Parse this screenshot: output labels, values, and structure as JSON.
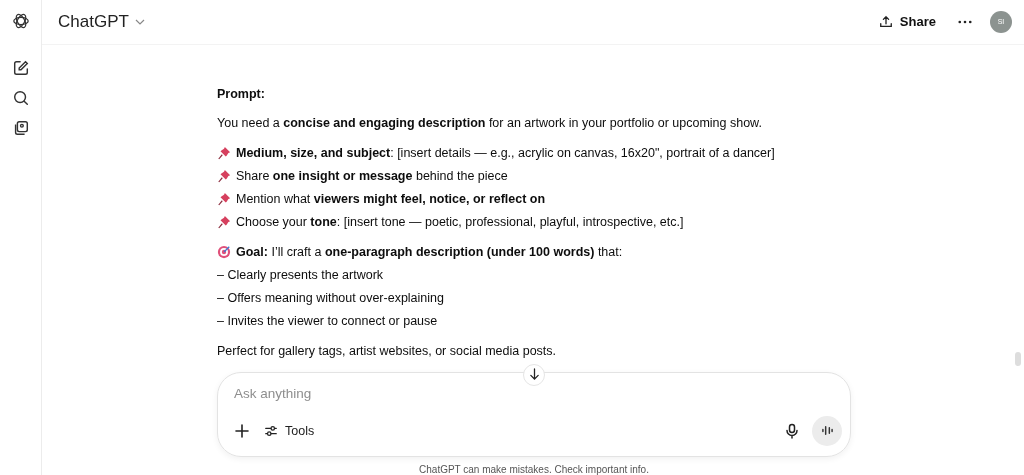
{
  "header": {
    "title": "ChatGPT",
    "share": "Share",
    "avatar": "SI"
  },
  "message": {
    "heading": "Prompt:",
    "intro": "You need a **concise and engaging description** for an artwork in your portfolio or upcoming show.",
    "bullets": [
      {
        "kind": "pin",
        "text": "**Medium, size, and subject**: [insert details — e.g., acrylic on canvas, 16x20\", portrait of a dancer]"
      },
      {
        "kind": "pin",
        "text": "Share **one insight or message** behind the piece"
      },
      {
        "kind": "pin",
        "text": "Mention what **viewers might feel, notice, or reflect on**"
      },
      {
        "kind": "pin",
        "text": "Choose your **tone**: [insert tone — poetic, professional, playful, introspective, etc.]"
      }
    ],
    "goal": {
      "kind": "target",
      "text": "**Goal:** I’ll craft a **one-paragraph description (under 100 words)** that:"
    },
    "dash_lines": [
      "– Clearly presents the artwork",
      "– Offers meaning without over-explaining",
      "– Invites the viewer to connect or pause"
    ],
    "closing": "Perfect for gallery tags, artist websites, or social media posts."
  },
  "composer": {
    "placeholder": "Ask anything",
    "tools": "Tools"
  },
  "disclaimer": "ChatGPT can make mistakes. Check important info."
}
